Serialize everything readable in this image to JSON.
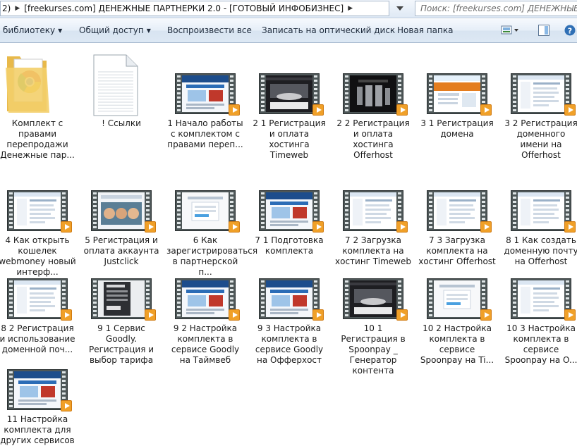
{
  "address": {
    "path": [
      "2)",
      "[freekurses.com] ДЕНЕЖНЫЕ ПАРТНЕРКИ 2.0 - [ГОТОВЫЙ ИНФОБИЗНЕС]"
    ],
    "search_placeholder": "Поиск: [freekurses.com] ДЕНЕЖНЫЕ ПАР..."
  },
  "toolbar": {
    "library": "библиотеку",
    "share": "Общий доступ",
    "play_all": "Воспроизвести все",
    "burn": "Записать на оптический диск",
    "new_folder": "Новая папка"
  },
  "items": [
    {
      "label": "Комплект с правами перепродажи Денежные пар...",
      "kind": "folder"
    },
    {
      "label": "! Ссылки",
      "kind": "file"
    },
    {
      "label": "1 Начало работы с комплектом с правами переп...",
      "kind": "video",
      "style": "blue"
    },
    {
      "label": "2 1 Регистрация и оплата хостинга Timeweb",
      "kind": "video",
      "style": "dark"
    },
    {
      "label": "2 2 Регистрация и оплата хостинга Offerhost",
      "kind": "video",
      "style": "server"
    },
    {
      "label": "3 1  Регистрация домена",
      "kind": "video",
      "style": "web"
    },
    {
      "label": "3 2 Регистрация доменного имени на Offerhost",
      "kind": "video",
      "style": "form"
    },
    {
      "label": "4 Как открыть кошелек webmoney новый интерф...",
      "kind": "video",
      "style": "form"
    },
    {
      "label": "5 Регистрация и оплата аккаунта Justclick",
      "kind": "video",
      "style": "faces"
    },
    {
      "label": "6 Как зарегистрироватьcя в партнерской п...",
      "kind": "video",
      "style": "plain"
    },
    {
      "label": "7 1 Подготовка комплекта",
      "kind": "video",
      "style": "blue"
    },
    {
      "label": "7 2 Загрузка комплекта на хостинг Timeweb",
      "kind": "video",
      "style": "form"
    },
    {
      "label": "7 3 Загрузка комплекта на хостинг Offerhost",
      "kind": "video",
      "style": "form"
    },
    {
      "label": "8 1 Как создать доменную почту на Offerhost",
      "kind": "video",
      "style": "form"
    },
    {
      "label": "8 2 Регистрация и использование доменной поч...",
      "kind": "video",
      "style": "form"
    },
    {
      "label": "9 1 Сервис Goodly. Регистрация и выбор тарифа",
      "kind": "video",
      "style": "goodly"
    },
    {
      "label": "9 2 Настройка комплекта в сервисе Goodly на Таймвеб",
      "kind": "video",
      "style": "blue"
    },
    {
      "label": "9 3 Настройка комплекта в сервисе Goodly на Офферхост",
      "kind": "video",
      "style": "blue"
    },
    {
      "label": "10 1 Регистрация в Spoonpay _ Генератор контента",
      "kind": "video",
      "style": "dark"
    },
    {
      "label": "10 2 Настройка комплекта в сервисе Spoonpay на Ti...",
      "kind": "video",
      "style": "plain"
    },
    {
      "label": "10 3 Настройка комплекта в сервисе Spoonpay на O...",
      "kind": "video",
      "style": "form"
    },
    {
      "label": "11  Настройка комплекта для других сервисов",
      "kind": "video",
      "style": "blue"
    }
  ]
}
